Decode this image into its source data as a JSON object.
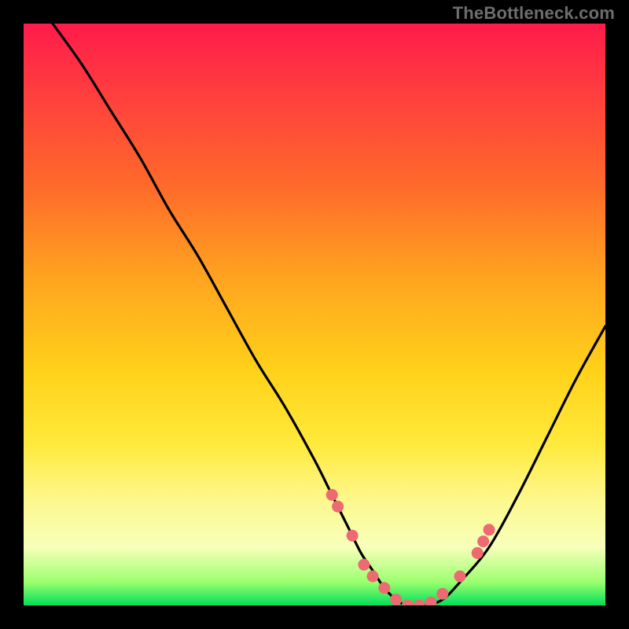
{
  "watermark": "TheBottleneck.com",
  "chart_data": {
    "type": "line",
    "title": "",
    "xlabel": "",
    "ylabel": "",
    "xlim": [
      0,
      100
    ],
    "ylim": [
      0,
      100
    ],
    "grid": false,
    "legend": false,
    "series": [
      {
        "name": "curve",
        "x": [
          5,
          10,
          15,
          20,
          25,
          30,
          35,
          40,
          45,
          50,
          53,
          56,
          58,
          60,
          62,
          64,
          66,
          69,
          72,
          75,
          80,
          85,
          90,
          95,
          100
        ],
        "values": [
          100,
          93,
          85,
          77,
          68,
          60,
          51,
          42,
          34,
          25,
          19,
          13,
          9,
          6,
          3,
          1,
          0,
          0,
          1,
          4,
          10,
          19,
          29,
          39,
          48
        ]
      }
    ],
    "markers": [
      {
        "x": 53,
        "y": 19
      },
      {
        "x": 54,
        "y": 17
      },
      {
        "x": 56.5,
        "y": 12
      },
      {
        "x": 58.5,
        "y": 7
      },
      {
        "x": 60,
        "y": 5
      },
      {
        "x": 62,
        "y": 3
      },
      {
        "x": 64,
        "y": 1
      },
      {
        "x": 66,
        "y": 0
      },
      {
        "x": 68,
        "y": 0
      },
      {
        "x": 70,
        "y": 0.5
      },
      {
        "x": 72,
        "y": 2
      },
      {
        "x": 75,
        "y": 5
      },
      {
        "x": 78,
        "y": 9
      },
      {
        "x": 79,
        "y": 11
      },
      {
        "x": 80,
        "y": 13
      }
    ],
    "gradient_stops": [
      {
        "pos": 0,
        "color": "#ff1b4a"
      },
      {
        "pos": 12,
        "color": "#ff3e3e"
      },
      {
        "pos": 28,
        "color": "#ff6a2a"
      },
      {
        "pos": 44,
        "color": "#ffa51f"
      },
      {
        "pos": 60,
        "color": "#ffd21a"
      },
      {
        "pos": 72,
        "color": "#ffe93a"
      },
      {
        "pos": 82,
        "color": "#fdf88e"
      },
      {
        "pos": 90,
        "color": "#f7ffba"
      },
      {
        "pos": 96,
        "color": "#9bff6e"
      },
      {
        "pos": 100,
        "color": "#00e05a"
      }
    ],
    "marker_color": "#ed6a72",
    "curve_color": "#000000"
  }
}
